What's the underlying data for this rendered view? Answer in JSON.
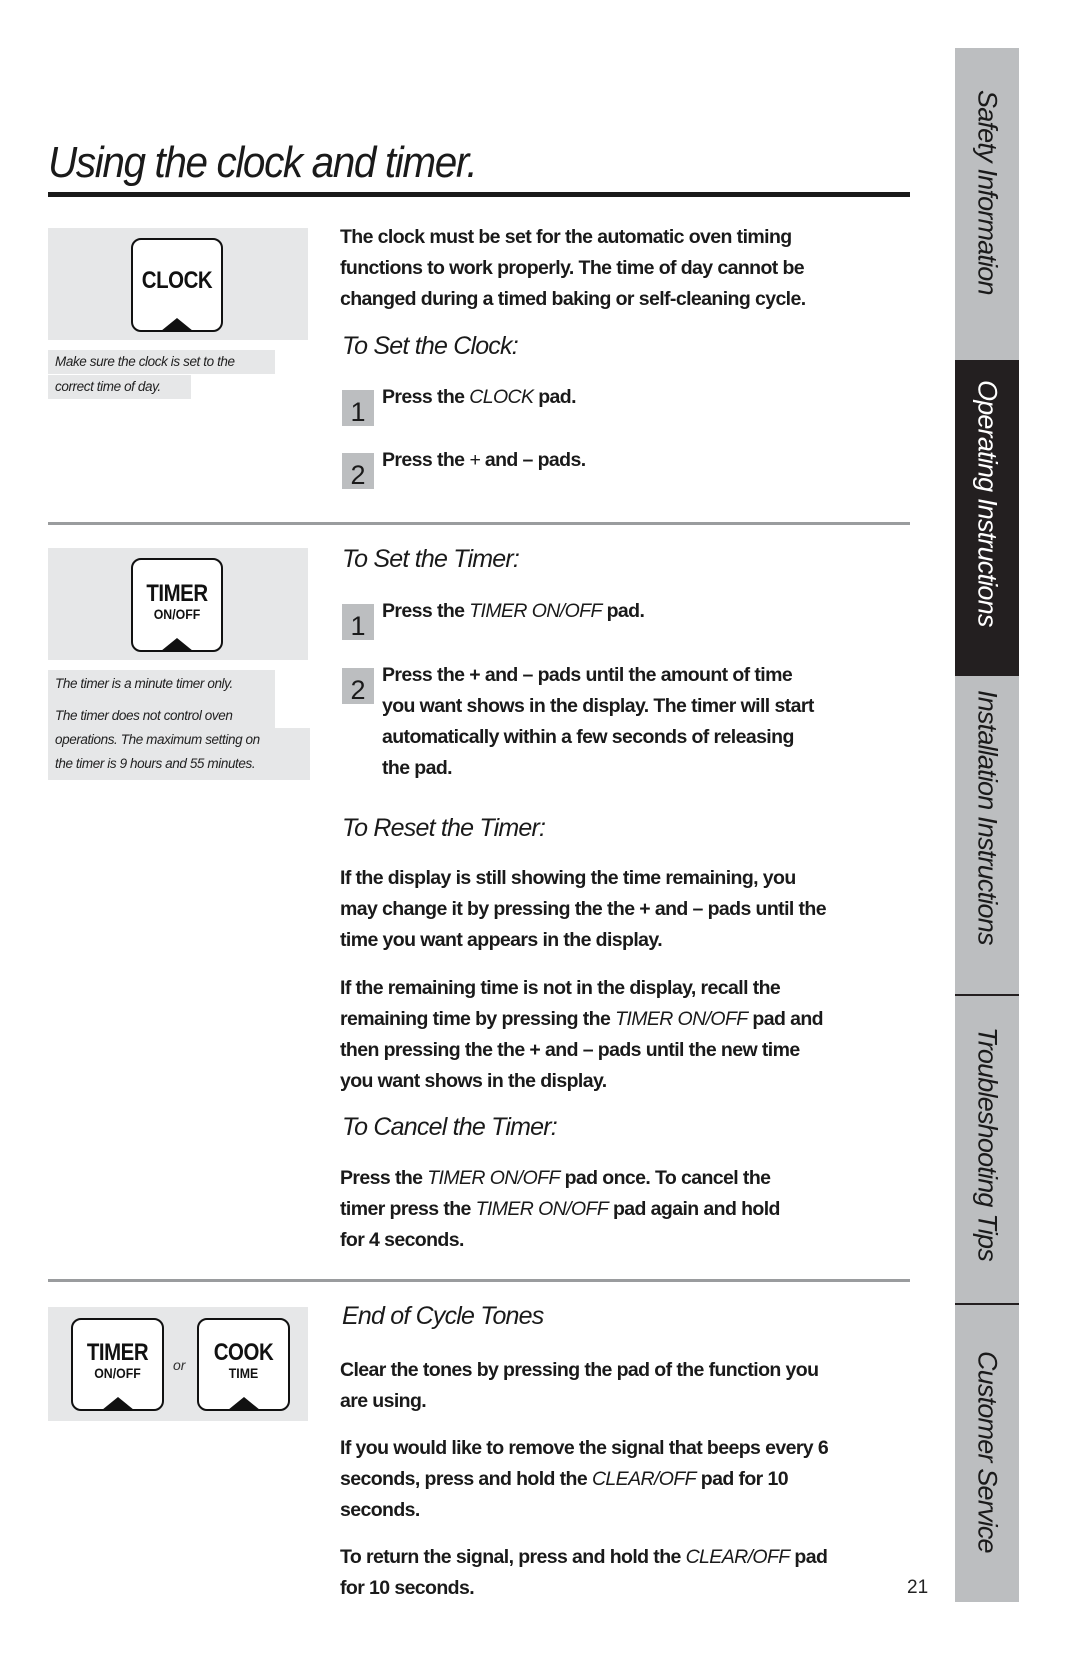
{
  "page": {
    "title": "Using the clock and timer.",
    "page_number": "21"
  },
  "side_tabs": [
    {
      "label": "Safety Information",
      "active": false
    },
    {
      "label": "Operating Instructions",
      "active": true
    },
    {
      "label": "Installation Instructions",
      "active": false
    },
    {
      "label": "Troubleshooting Tips",
      "active": false
    },
    {
      "label": "Customer Service",
      "active": false
    }
  ],
  "clock_section": {
    "pad": {
      "label": "CLOCK",
      "icon": "clock-pad-icon"
    },
    "notes": [
      "Make sure the clock is set to the",
      "correct time of day."
    ],
    "intro_lines": [
      "The clock must be set for the automatic oven timing",
      "functions to work properly. The time of day cannot be",
      "changed during a timed baking or self-cleaning cycle."
    ],
    "subheading": "To Set the Clock:",
    "steps": [
      {
        "number": "1",
        "pre": "Press the ",
        "pad": "CLOCK",
        "post": " pad."
      },
      {
        "number": "2",
        "pre": "Press the ",
        "pad": "+",
        "mid": " and ",
        "pad2": "–",
        "post": " pads."
      }
    ]
  },
  "timer_section": {
    "pad": {
      "label": "TIMER",
      "sublabel": "ON/OFF",
      "icon": "timer-pad-icon"
    },
    "notes": [
      "The timer is a minute timer only.",
      "The timer does not control oven",
      "operations. The maximum setting on",
      "the timer is 9 hours and 55 minutes."
    ],
    "set": {
      "subheading": "To Set the Timer:",
      "steps": [
        {
          "number": "1",
          "pre": "Press the ",
          "pad": "TIMER ON/OFF",
          "post": " pad."
        },
        {
          "number": "2",
          "lines": [
            "Press the + and – pads until the amount of time",
            "you want shows in the display. The timer will start",
            "automatically within a few seconds of releasing",
            "the pad."
          ]
        }
      ]
    },
    "reset": {
      "subheading": "To Reset the Timer:",
      "para1": [
        "If the display is still showing the time remaining, you",
        "may change it by pressing the the + and – pads until the",
        "time you want appears in the display."
      ],
      "para2": {
        "line1": "If the remaining time is not in the display, recall the",
        "line2_pre": "remaining time by pressing the ",
        "line2_pad": "TIMER ON/OFF",
        "line2_post": " pad and",
        "line3": "then pressing the the + and – pads until the new time",
        "line4": "you want shows in the display."
      }
    },
    "cancel": {
      "subheading": "To Cancel the Timer:",
      "line1_pre": "Press the ",
      "line1_pad": "TIMER ON/OFF",
      "line1_post": " pad once. To cancel the",
      "line2_pre": "timer press the ",
      "line2_pad": "TIMER ON/OFF",
      "line2_post": " pad again and hold",
      "line3": "for 4 seconds."
    }
  },
  "tones_section": {
    "pads": [
      {
        "label": "TIMER",
        "sublabel": "ON/OFF"
      },
      {
        "label": "COOK",
        "sublabel": "TIME"
      }
    ],
    "or_label": "or",
    "subheading": "End of Cycle Tones",
    "para1": [
      "Clear the tones by pressing the pad of the function you",
      "are using."
    ],
    "para2": {
      "line1": "If you would like to remove the signal that beeps every 6",
      "line2_pre": "seconds, press and hold the ",
      "line2_pad": "CLEAR/OFF",
      "line2_post": " pad for 10",
      "line3": "seconds."
    },
    "para3": {
      "line1_pre": "To return the signal, press and hold the ",
      "line1_pad": "CLEAR/OFF",
      "line1_post": " pad",
      "line2": "for 10 seconds."
    }
  }
}
